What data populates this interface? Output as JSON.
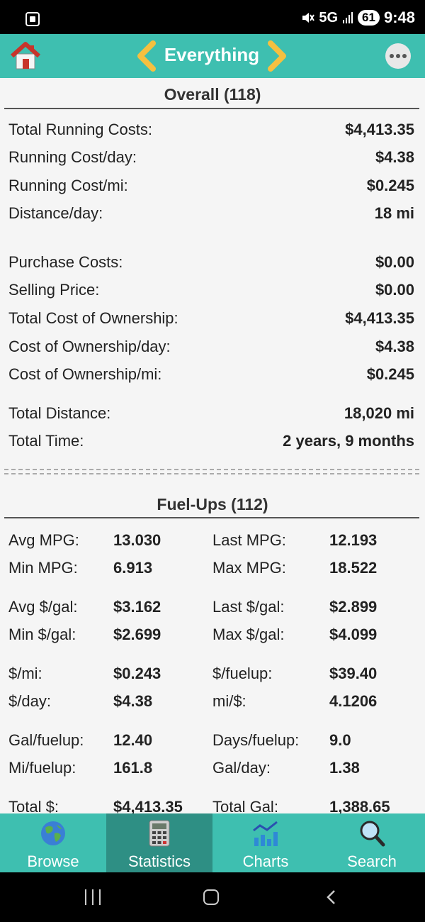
{
  "status_bar": {
    "network": "5G",
    "battery": "61",
    "time": "9:48"
  },
  "app_bar": {
    "title": "Everything",
    "home_icon": "home-icon",
    "prev_icon": "chevron-left-icon",
    "next_icon": "chevron-right-icon",
    "more_icon": "more-options-icon"
  },
  "overall": {
    "header": "Overall (118)",
    "group1": [
      {
        "label": "Total Running Costs:",
        "value": "$4,413.35"
      },
      {
        "label": "Running Cost/day:",
        "value": "$4.38"
      },
      {
        "label": "Running Cost/mi:",
        "value": "$0.245"
      },
      {
        "label": "Distance/day:",
        "value": "18 mi"
      }
    ],
    "group2": [
      {
        "label": "Purchase Costs:",
        "value": "$0.00"
      },
      {
        "label": "Selling Price:",
        "value": "$0.00"
      },
      {
        "label": "Total Cost of Ownership:",
        "value": "$4,413.35"
      },
      {
        "label": "Cost of Ownership/day:",
        "value": "$4.38"
      },
      {
        "label": "Cost of Ownership/mi:",
        "value": "$0.245"
      }
    ],
    "group3": [
      {
        "label": "Total Distance:",
        "value": "18,020 mi"
      },
      {
        "label": "Total Time:",
        "value": "2 years, 9 months"
      }
    ]
  },
  "fuelups": {
    "header": "Fuel-Ups (112)",
    "rows": [
      {
        "l_label": "Avg MPG:",
        "l_value": "13.030",
        "r_label": "Last MPG:",
        "r_value": "12.193"
      },
      {
        "l_label": "Min MPG:",
        "l_value": "6.913",
        "r_label": "Max MPG:",
        "r_value": "18.522"
      },
      {
        "l_label": "Avg $/gal:",
        "l_value": "$3.162",
        "r_label": "Last $/gal:",
        "r_value": "$2.899"
      },
      {
        "l_label": "Min $/gal:",
        "l_value": "$2.699",
        "r_label": "Max $/gal:",
        "r_value": "$4.099"
      },
      {
        "l_label": "$/mi:",
        "l_value": "$0.243",
        "r_label": "$/fuelup:",
        "r_value": "$39.40"
      },
      {
        "l_label": "$/day:",
        "l_value": "$4.38",
        "r_label": "mi/$:",
        "r_value": "4.1206"
      },
      {
        "l_label": "Gal/fuelup:",
        "l_value": "12.40",
        "r_label": "Days/fuelup:",
        "r_value": "9.0"
      },
      {
        "l_label": "Mi/fuelup:",
        "l_value": "161.8",
        "r_label": "Gal/day:",
        "r_value": "1.38"
      },
      {
        "l_label": "Total $:",
        "l_value": "$4,413.35",
        "r_label": "Total Gal:",
        "r_value": "1,388.65"
      }
    ]
  },
  "bottom_nav": [
    {
      "label": "Browse",
      "icon": "globe-icon",
      "active": false
    },
    {
      "label": "Statistics",
      "icon": "calculator-icon",
      "active": true
    },
    {
      "label": "Charts",
      "icon": "chart-icon",
      "active": false
    },
    {
      "label": "Search",
      "icon": "magnifier-icon",
      "active": false
    }
  ],
  "colors": {
    "accent": "#3ebfb0",
    "active_tab": "#2e8f84",
    "chevron": "#f5c040"
  }
}
